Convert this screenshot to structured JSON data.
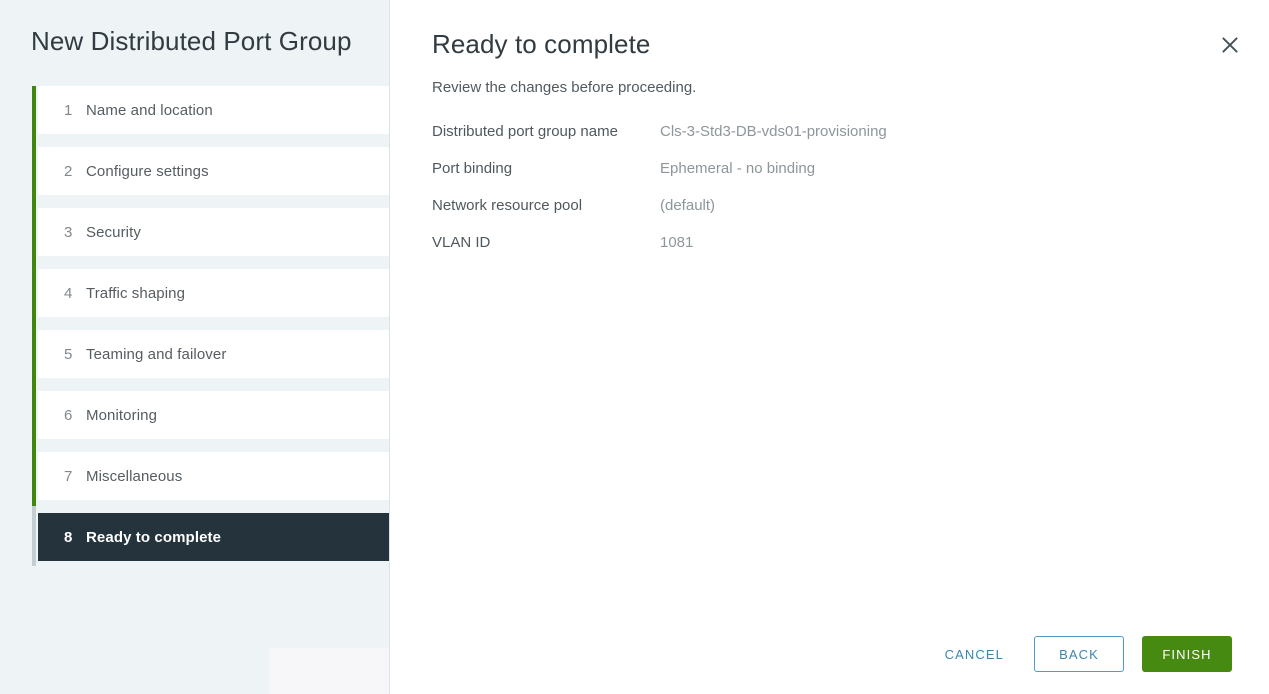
{
  "sidebar": {
    "title": "New Distributed Port Group",
    "steps": [
      {
        "num": "1",
        "label": "Name and location",
        "state": "done"
      },
      {
        "num": "2",
        "label": "Configure settings",
        "state": "done"
      },
      {
        "num": "3",
        "label": "Security",
        "state": "done"
      },
      {
        "num": "4",
        "label": "Traffic shaping",
        "state": "done"
      },
      {
        "num": "5",
        "label": "Teaming and failover",
        "state": "done"
      },
      {
        "num": "6",
        "label": "Monitoring",
        "state": "done"
      },
      {
        "num": "7",
        "label": "Miscellaneous",
        "state": "done"
      },
      {
        "num": "8",
        "label": "Ready to complete",
        "state": "active"
      }
    ]
  },
  "main": {
    "title": "Ready to complete",
    "subtitle": "Review the changes before proceeding.",
    "close_icon": "close-icon",
    "summary": [
      {
        "label": "Distributed port group name",
        "value": "Cls-3-Std3-DB-vds01-provisioning"
      },
      {
        "label": "Port binding",
        "value": "Ephemeral - no binding"
      },
      {
        "label": "Network resource pool",
        "value": "(default)"
      },
      {
        "label": "VLAN ID",
        "value": "1081"
      }
    ]
  },
  "footer": {
    "cancel_label": "CANCEL",
    "back_label": "BACK",
    "finish_label": "FINISH"
  },
  "colors": {
    "accent_green": "#478a12",
    "rail_done": "#41860f",
    "rail_current": "#c2cdd4",
    "active_step_bg": "#25333d",
    "link_blue": "#3b86b0",
    "sidebar_bg": "#eef3f6"
  }
}
